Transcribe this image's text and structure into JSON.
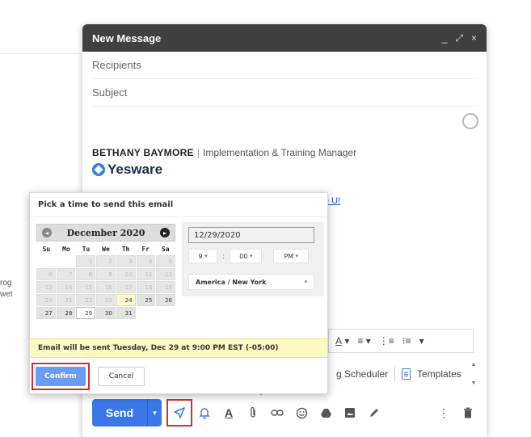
{
  "background": {
    "fragment_1": "rog",
    "fragment_2": "wet"
  },
  "compose": {
    "title": "New Message",
    "minimize_label": "_",
    "expand_label": "⤢",
    "close_label": "×",
    "recipients_placeholder": "Recipients",
    "subject_placeholder": "Subject",
    "signature": {
      "name": "BETHANY BAYMORE",
      "separator": "|",
      "role": "Implementation & Training Manager",
      "logo_text": "Yesware",
      "link_fragment": "e U!"
    },
    "format_toolbar": {
      "text_color": "A",
      "align": "≡",
      "numbered_list": "⋮≡",
      "bullet_list": "⁝≡",
      "more": "▾"
    },
    "addons": {
      "scheduler_label": "g Scheduler",
      "templates_label": "Templates"
    },
    "bottom_toolbar": {
      "send_label": "Send",
      "send_dropdown": "▾"
    }
  },
  "scheduler": {
    "title": "Pick a time to send this email",
    "calendar": {
      "month_label": "December 2020",
      "prev_icon": "◂",
      "next_icon": "▸",
      "weekdays": [
        "Su",
        "Mo",
        "Tu",
        "We",
        "Th",
        "Fr",
        "Sa"
      ],
      "days": [
        {
          "label": "",
          "state": "blank"
        },
        {
          "label": "",
          "state": "blank"
        },
        {
          "label": "1",
          "state": "disabled"
        },
        {
          "label": "2",
          "state": "disabled"
        },
        {
          "label": "3",
          "state": "disabled"
        },
        {
          "label": "4",
          "state": "disabled"
        },
        {
          "label": "5",
          "state": "disabled"
        },
        {
          "label": "6",
          "state": "disabled"
        },
        {
          "label": "7",
          "state": "disabled"
        },
        {
          "label": "8",
          "state": "disabled"
        },
        {
          "label": "9",
          "state": "disabled"
        },
        {
          "label": "10",
          "state": "disabled"
        },
        {
          "label": "11",
          "state": "disabled"
        },
        {
          "label": "12",
          "state": "disabled"
        },
        {
          "label": "13",
          "state": "disabled"
        },
        {
          "label": "14",
          "state": "disabled"
        },
        {
          "label": "15",
          "state": "disabled"
        },
        {
          "label": "16",
          "state": "disabled"
        },
        {
          "label": "17",
          "state": "disabled"
        },
        {
          "label": "18",
          "state": "disabled"
        },
        {
          "label": "19",
          "state": "disabled"
        },
        {
          "label": "20",
          "state": "disabled"
        },
        {
          "label": "21",
          "state": "disabled"
        },
        {
          "label": "22",
          "state": "disabled"
        },
        {
          "label": "23",
          "state": "disabled"
        },
        {
          "label": "24",
          "state": "today"
        },
        {
          "label": "25",
          "state": "active"
        },
        {
          "label": "26",
          "state": "active"
        },
        {
          "label": "27",
          "state": "active"
        },
        {
          "label": "28",
          "state": "active"
        },
        {
          "label": "29",
          "state": "selected"
        },
        {
          "label": "30",
          "state": "active"
        },
        {
          "label": "31",
          "state": "active"
        }
      ]
    },
    "date_value": "12/29/2020",
    "hour_value": "9",
    "minute_value": "00",
    "ampm_value": "PM",
    "timezone_value": "America / New York",
    "notice": "Email will be sent Tuesday, Dec 29 at 9:00 PM EST (-05:00)",
    "confirm_label": "Confirm",
    "cancel_label": "Cancel"
  },
  "colors": {
    "accent": "#3b78e7",
    "highlight": "#d32f2f",
    "notice_bg": "#fef9c3"
  }
}
